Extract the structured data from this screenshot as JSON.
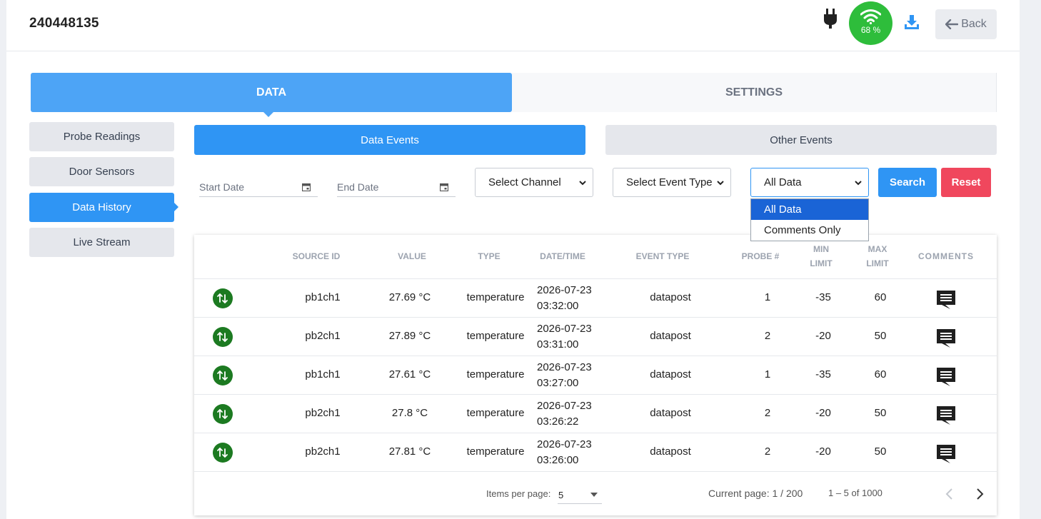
{
  "header": {
    "device_id": "240448135",
    "wifi_percent": "68 %",
    "back_label": "Back"
  },
  "main_tabs": [
    {
      "label": "DATA",
      "active": true
    },
    {
      "label": "SETTINGS",
      "active": false
    }
  ],
  "sidebar": {
    "items": [
      {
        "label": "Probe Readings",
        "active": false
      },
      {
        "label": "Door Sensors",
        "active": false
      },
      {
        "label": "Data History",
        "active": true
      },
      {
        "label": "Live Stream",
        "active": false
      }
    ]
  },
  "sub_tabs": [
    {
      "label": "Data Events",
      "active": true
    },
    {
      "label": "Other Events",
      "active": false
    }
  ],
  "filters": {
    "start_date_label": "Start Date",
    "end_date_label": "End Date",
    "channel_label": "Select Channel",
    "event_type_label": "Select Event Type",
    "data_filter_value": "All Data",
    "search_label": "Search",
    "reset_label": "Reset",
    "data_filter_options": [
      {
        "label": "All Data",
        "selected": true
      },
      {
        "label": "Comments Only",
        "selected": false
      }
    ]
  },
  "table": {
    "headers": {
      "source_id": "SOURCE ID",
      "value": "VALUE",
      "type": "TYPE",
      "datetime": "DATE/TIME",
      "event_type": "EVENT TYPE",
      "probe": "PROBE #",
      "min_limit_1": "MIN",
      "min_limit_2": "LIMIT",
      "max_limit_1": "MAX",
      "max_limit_2": "LIMIT",
      "comments": "COMMENTS"
    },
    "rows": [
      {
        "source_id": "pb1ch1",
        "value": "27.69 °C",
        "type": "temperature",
        "date": "2026-07-23",
        "time": "03:32:00",
        "event_type": "datapost",
        "probe": "1",
        "min_limit": "-35",
        "max_limit": "60"
      },
      {
        "source_id": "pb2ch1",
        "value": "27.89 °C",
        "type": "temperature",
        "date": "2026-07-23",
        "time": "03:31:00",
        "event_type": "datapost",
        "probe": "2",
        "min_limit": "-20",
        "max_limit": "50"
      },
      {
        "source_id": "pb1ch1",
        "value": "27.61 °C",
        "type": "temperature",
        "date": "2026-07-23",
        "time": "03:27:00",
        "event_type": "datapost",
        "probe": "1",
        "min_limit": "-35",
        "max_limit": "60"
      },
      {
        "source_id": "pb2ch1",
        "value": "27.8 °C",
        "type": "temperature",
        "date": "2026-07-23",
        "time": "03:26:22",
        "event_type": "datapost",
        "probe": "2",
        "min_limit": "-20",
        "max_limit": "50"
      },
      {
        "source_id": "pb2ch1",
        "value": "27.81 °C",
        "type": "temperature",
        "date": "2026-07-23",
        "time": "03:26:00",
        "event_type": "datapost",
        "probe": "2",
        "min_limit": "-20",
        "max_limit": "50"
      }
    ]
  },
  "pagination": {
    "items_per_page_label": "Items per page:",
    "items_per_page_value": "5",
    "current_page_label": "Current page: 1 / 200",
    "range_label": "1 – 5 of 1000"
  },
  "colors": {
    "primary": "#2f95f4",
    "tab_active": "#4da4f6",
    "wifi_green": "#2ebd3b",
    "reset_red": "#f0475d",
    "event_icon_green": "#1c7a21"
  }
}
